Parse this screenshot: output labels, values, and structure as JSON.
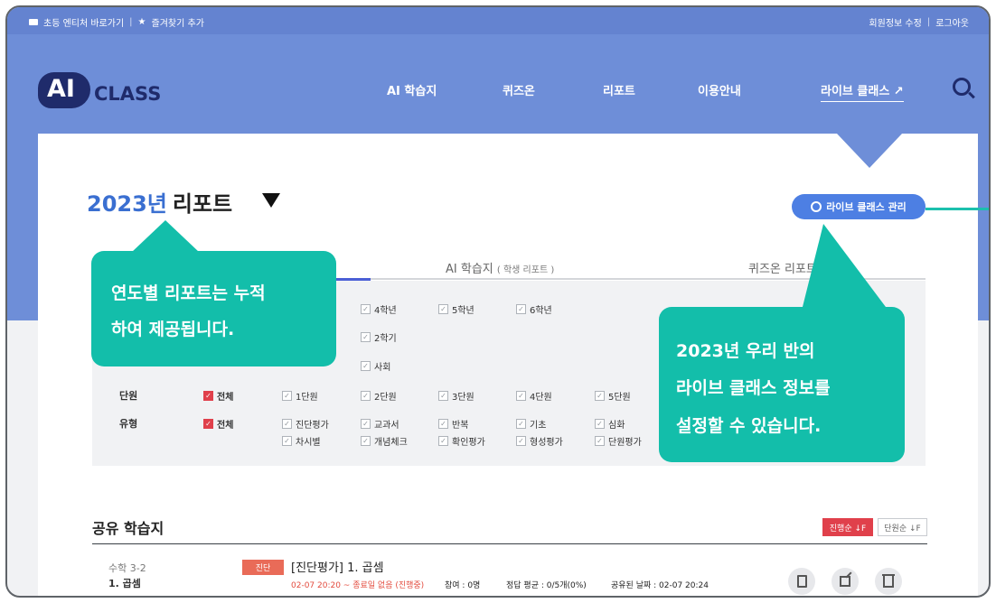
{
  "topbar": {
    "left_items": [
      "초등 엔티처 바로가기",
      "즐겨찾기 추가"
    ],
    "right_items": [
      "회원정보 수정",
      "로그아웃"
    ]
  },
  "brand": {
    "logo_ai": "AI",
    "logo_class": "CLASS"
  },
  "nav": {
    "items": [
      "AI 학습지",
      "퀴즈온",
      "리포트",
      "이용안내",
      "라이브 클래스 ↗"
    ]
  },
  "report": {
    "year": "2023년",
    "title": "리포트",
    "live_class_button": "라이브 클래스 관리"
  },
  "tabs": [
    {
      "label": "AI 학습지",
      "sub": "( 학생 리포트 )"
    },
    {
      "label": "퀴즈온 리포트",
      "sub": ""
    }
  ],
  "filters": {
    "top_visible": [
      "4학년",
      "5학년",
      "6학년",
      "2학기",
      "사회"
    ],
    "units": {
      "label": "단원",
      "all": "전체",
      "items": [
        "1단원",
        "2단원",
        "3단원",
        "4단원",
        "5단원"
      ]
    },
    "types": {
      "label": "유형",
      "all": "전체",
      "row1": [
        "진단평가",
        "교과서",
        "반복",
        "기초",
        "심화"
      ],
      "row2": [
        "차시별",
        "개념체크",
        "확인평가",
        "형성평가",
        "단원평가"
      ]
    }
  },
  "callouts": {
    "left": [
      "연도별 리포트는 누적",
      "하여 제공됩니다."
    ],
    "right": [
      "2023년 우리 반의",
      "라이브 클래스 정보를",
      "설정할 수 있습니다."
    ]
  },
  "shared": {
    "title": "공유 학습지",
    "sort_progress": "진행순 ↓F",
    "sort_unit": "단원순 ↓F",
    "row": {
      "subject": "수학 3-2",
      "unit": "1. 곱셈",
      "badge": "진단",
      "title": "[진단평가] 1. 곱셈",
      "date": "02-07 20:20 ~ 종료일 없음 (진행중)",
      "participants": "참여 : 0명",
      "avg": "정답 평균 : 0/5개(0%)",
      "shared_date": "공유된 날짜 : 02-07 20:24"
    }
  }
}
